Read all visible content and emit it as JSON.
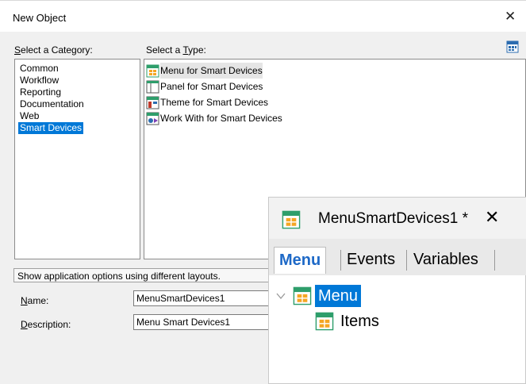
{
  "dialog": {
    "title": "New Object",
    "close_glyph": "✕"
  },
  "category": {
    "label_prefix": "S",
    "label_rest": "elect a Category:",
    "items": [
      "Common",
      "Workflow",
      "Reporting",
      "Documentation",
      "Web",
      "Smart Devices"
    ],
    "selected": "Smart Devices"
  },
  "type": {
    "label_before": "Select a ",
    "label_underlined": "T",
    "label_after": "ype:",
    "items": [
      {
        "label": "Menu for Smart Devices",
        "icon": "menu-icon"
      },
      {
        "label": "Panel for Smart Devices",
        "icon": "panel-icon"
      },
      {
        "label": "Theme for Smart Devices",
        "icon": "theme-icon"
      },
      {
        "label": "Work With for Smart Devices",
        "icon": "workwith-icon"
      }
    ],
    "selected": "Menu for Smart Devices"
  },
  "description_text": "Show application options using different layouts.",
  "fields": {
    "name_label_u": "N",
    "name_label_rest": "ame:",
    "name_value": "MenuSmartDevices1",
    "description_label_u": "D",
    "description_label_rest": "escription:",
    "description_value": "Menu Smart Devices1"
  },
  "overlay": {
    "title": "MenuSmartDevices1 *",
    "close_glyph": "✕",
    "tabs": [
      "Menu",
      "Events",
      "Variables"
    ],
    "active_tab": "Menu",
    "tree": {
      "root": "Menu",
      "child": "Items"
    }
  },
  "colors": {
    "selection": "#0078d7",
    "active_tab_text": "#1e69c7",
    "icon_green": "#2e9e6b",
    "icon_orange": "#f5a623"
  }
}
